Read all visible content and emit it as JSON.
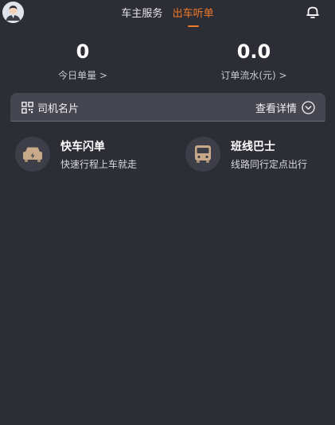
{
  "header": {
    "tabs": [
      {
        "label": "车主服务",
        "active": false
      },
      {
        "label": "出车听单",
        "active": true
      }
    ],
    "avatar_icon": "driver-avatar-icon",
    "notification_icon": "bell-icon"
  },
  "stats": {
    "orders_today": {
      "value": "0",
      "label": "今日单量 >"
    },
    "order_flow": {
      "value": "0.0",
      "label": "订单流水(元) >"
    }
  },
  "driver_card": {
    "title": "司机名片",
    "title_icon": "qr-code-icon",
    "details_label": "查看详情",
    "details_icon": "chevron-down-circle-icon"
  },
  "services": [
    {
      "title": "快车闪单",
      "subtitle": "快速行程上车就走",
      "icon": "fast-car-icon"
    },
    {
      "title": "班线巴士",
      "subtitle": "线路同行定点出行",
      "icon": "bus-icon"
    }
  ],
  "colors": {
    "background": "#2c2d35",
    "accent": "#f07a2a",
    "card": "#454650",
    "icon_accent": "#c8a98a"
  }
}
